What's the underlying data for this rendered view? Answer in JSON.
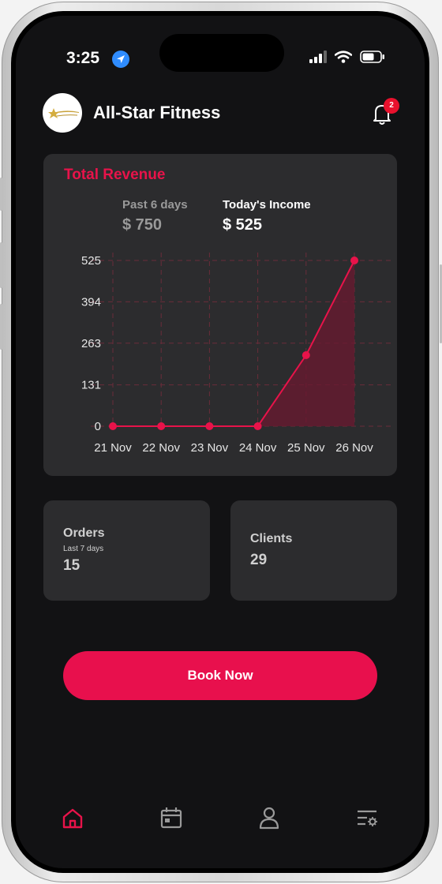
{
  "status_bar": {
    "time": "3:25"
  },
  "header": {
    "title": "All-Star Fitness",
    "notification_count": "2",
    "icons": [
      "avatar-logo",
      "bell-icon"
    ]
  },
  "revenue": {
    "title": "Total Revenue",
    "past_label": "Past 6 days",
    "past_value": "$ 750",
    "today_label": "Today's Income",
    "today_value": "$ 525"
  },
  "chart_data": {
    "type": "area",
    "title": "",
    "xlabel": "",
    "ylabel": "",
    "categories": [
      "21 Nov",
      "22 Nov",
      "23 Nov",
      "24 Nov",
      "25 Nov",
      "26 Nov"
    ],
    "y_ticks": [
      0,
      131,
      263,
      394,
      525
    ],
    "ylim": [
      0,
      525
    ],
    "grid": true,
    "series": [
      {
        "values": [
          0,
          0,
          0,
          0,
          225,
          525
        ]
      }
    ],
    "colors": {
      "line": "#e8134a",
      "fill": "#6b1830"
    }
  },
  "stats": {
    "orders_label": "Orders",
    "orders_sub": "Last 7 days",
    "orders_value": "15",
    "clients_label": "Clients",
    "clients_value": "29"
  },
  "cta": {
    "label": "Book Now"
  },
  "nav": {
    "items": [
      "home-icon",
      "calendar-icon",
      "user-icon",
      "settings-list-icon"
    ],
    "active": "home-icon"
  },
  "colors": {
    "accent": "#e8134a",
    "background": "#121214",
    "card": "#2c2c2e"
  }
}
